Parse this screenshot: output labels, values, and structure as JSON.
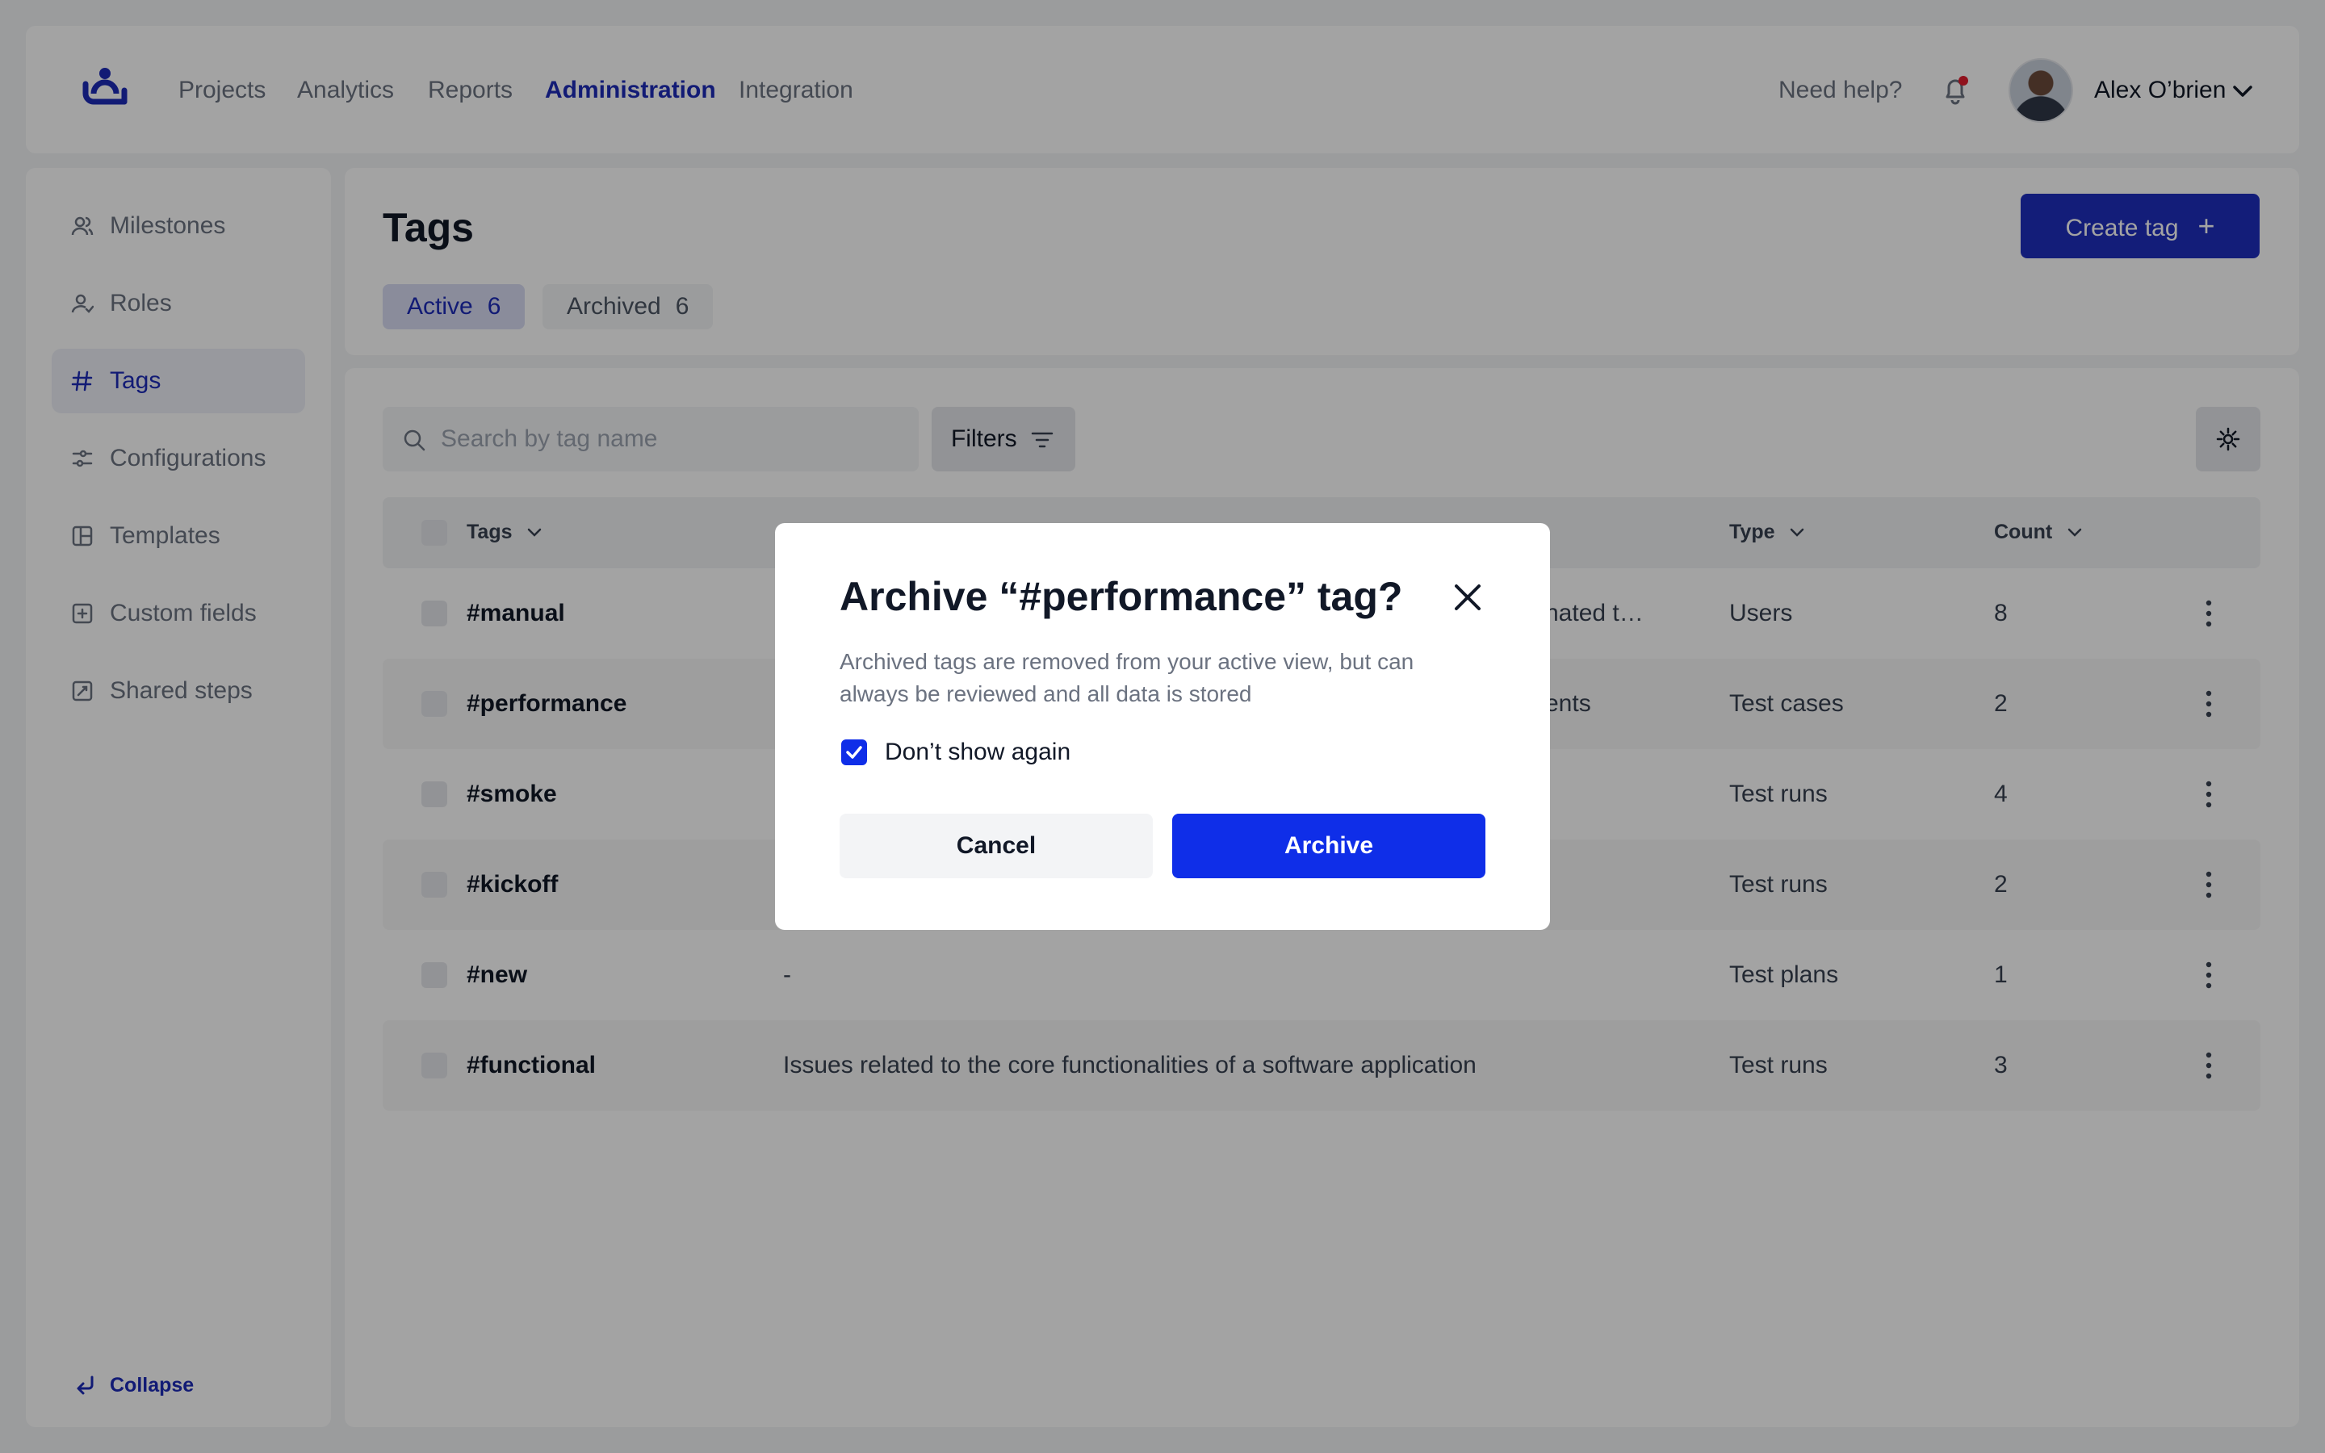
{
  "nav": {
    "items": [
      {
        "label": "Projects"
      },
      {
        "label": "Analytics"
      },
      {
        "label": "Reports"
      },
      {
        "label": "Administration"
      },
      {
        "label": "Integration"
      }
    ],
    "active": "Administration",
    "help_label": "Need help?",
    "user_name": "Alex O’brien",
    "notification_dot_color": "#e11d2e"
  },
  "sidebar": {
    "items": [
      {
        "label": "Milestones",
        "icon": "users-icon"
      },
      {
        "label": "Roles",
        "icon": "user-roles-icon"
      },
      {
        "label": "Tags",
        "icon": "hash-icon"
      },
      {
        "label": "Configurations",
        "icon": "sliders-icon"
      },
      {
        "label": "Templates",
        "icon": "layout-icon"
      },
      {
        "label": "Custom fields",
        "icon": "plus-square-icon"
      },
      {
        "label": "Shared steps",
        "icon": "edit-square-icon"
      }
    ],
    "active": "Tags",
    "collapse_label": "Collapse"
  },
  "page": {
    "title": "Tags",
    "create_button": "Create tag",
    "tabs": [
      {
        "label": "Active",
        "count": "6"
      },
      {
        "label": "Archived",
        "count": "6"
      }
    ],
    "active_tab": "Active",
    "accent_color": "#1e2ebd"
  },
  "toolbar": {
    "search_placeholder": "Search by tag name",
    "filters_label": "Filters"
  },
  "table": {
    "columns": [
      "Tags",
      "Type",
      "Count"
    ],
    "rows": [
      {
        "tag": "#manual",
        "description": "nated t…",
        "type": "Users",
        "count": "8"
      },
      {
        "tag": "#performance",
        "description": "ents",
        "type": "Test cases",
        "count": "2"
      },
      {
        "tag": "#smoke",
        "description": "",
        "type": "Test runs",
        "count": "4"
      },
      {
        "tag": "#kickoff",
        "description": "",
        "type": "Test runs",
        "count": "2"
      },
      {
        "tag": "#new",
        "description": "-",
        "type": "Test plans",
        "count": "1"
      },
      {
        "tag": "#functional",
        "description": "Issues related to the core functionalities of a software application",
        "type": "Test runs",
        "count": "3"
      }
    ]
  },
  "modal": {
    "title": "Archive “#performance” tag?",
    "description": "Archived tags are removed from your active view, but can always be reviewed and all data is stored",
    "checkbox_label": "Don’t show again",
    "checkbox_checked": true,
    "cancel_label": "Cancel",
    "archive_label": "Archive",
    "archive_color": "#0f2ee8"
  }
}
